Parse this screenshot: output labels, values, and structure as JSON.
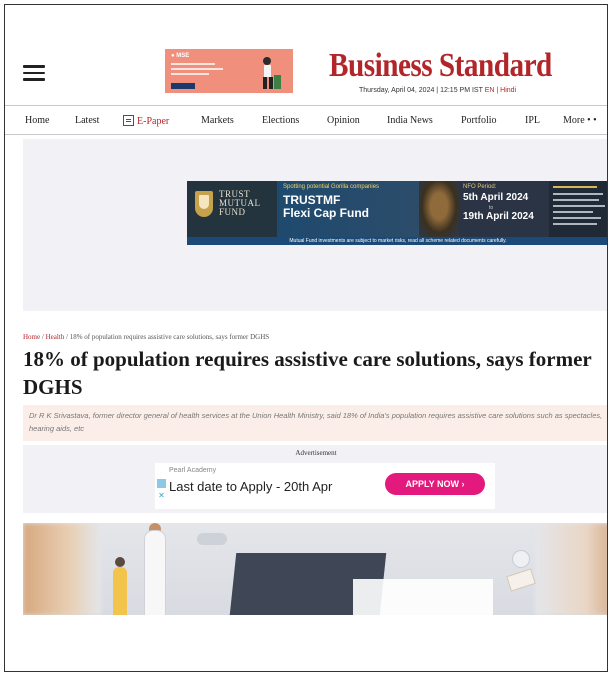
{
  "header": {
    "logo": "Business Standard",
    "dateline": "Thursday, April 04, 2024 | 12:15 PM IST",
    "language": "EN | Hindi"
  },
  "top_ad": {
    "brand": "● MSE"
  },
  "nav": {
    "items": [
      "Home",
      "Latest",
      "E-Paper",
      "Markets",
      "Elections",
      "Opinion",
      "India News",
      "Portfolio",
      "IPL",
      "More • •"
    ]
  },
  "banner_ad": {
    "brand": "TRUST MUTUAL FUND",
    "tagline": "Spotting potential Gorilla companies",
    "fund_name_1": "TRUSTMF",
    "fund_name_2": "Flexi Cap Fund",
    "nfo_label": "NFO Period:",
    "nfo_start": "5th April 2024",
    "nfo_to": "to",
    "nfo_end": "19th April 2024",
    "disclaimer": "Mutual Fund investments are subject to market risks, read all scheme related documents carefully."
  },
  "article": {
    "breadcrumb": {
      "home": "Home",
      "section": "Health",
      "current": "18% of population requires assistive care solutions, says former DGHS"
    },
    "headline": "18% of population requires assistive care solutions, says former DGHS",
    "summary": "Dr R K Srivastava, former director general of health services at the Union Health Ministry, said 18% of India's population requires assistive care solutions such as spectacles, hearing aids, etc"
  },
  "advertisement": {
    "label": "Advertisement",
    "brand": "Pearl Academy",
    "text": "Last date to Apply - 20th Apr",
    "button": "APPLY NOW ›"
  }
}
